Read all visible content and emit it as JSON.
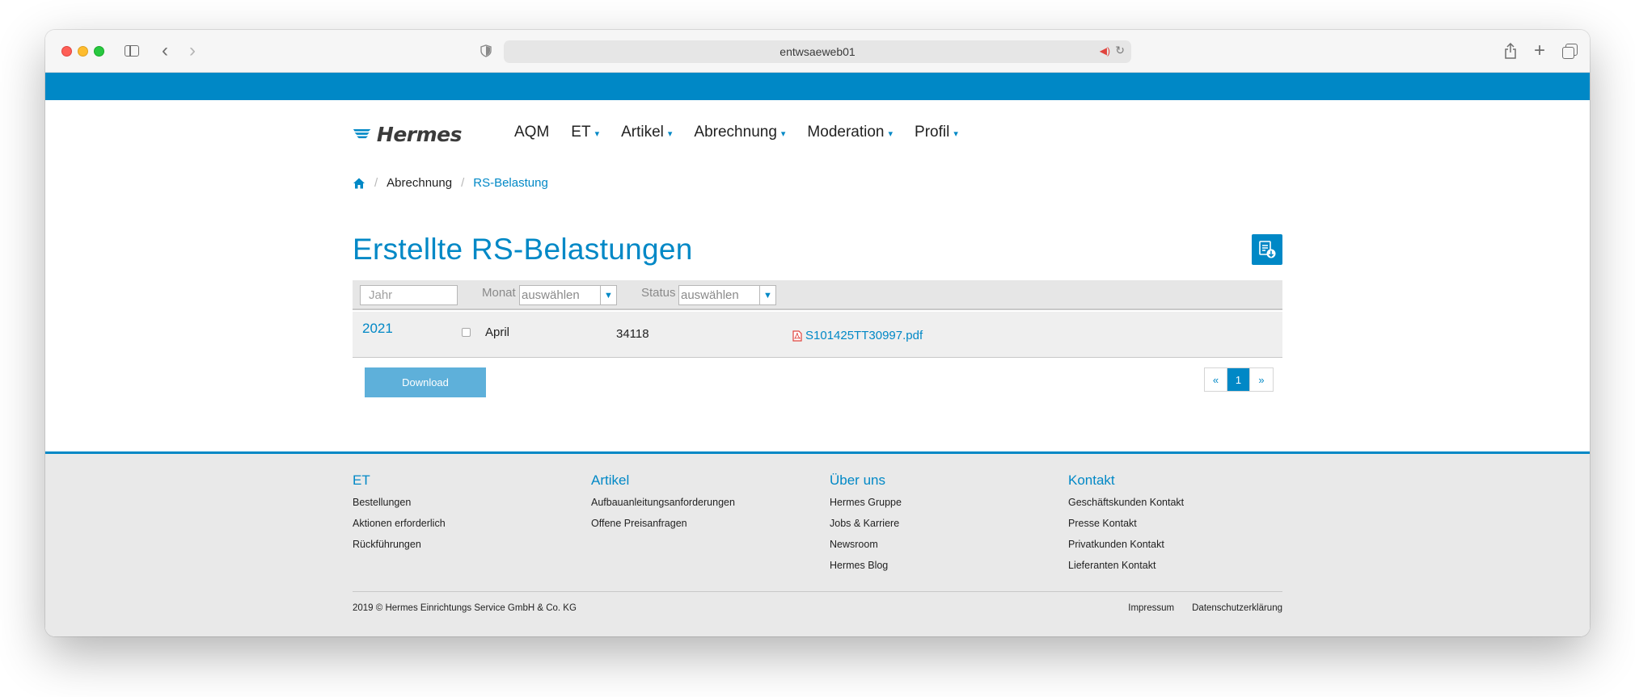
{
  "browser": {
    "url": "entwsaeweb01"
  },
  "brand": {
    "logo_text": "Hermes",
    "primary_color": "#0088c6"
  },
  "nav": {
    "items": [
      {
        "label": "AQM",
        "dropdown": false
      },
      {
        "label": "ET",
        "dropdown": true
      },
      {
        "label": "Artikel",
        "dropdown": true
      },
      {
        "label": "Abrechnung",
        "dropdown": true
      },
      {
        "label": "Moderation",
        "dropdown": true
      },
      {
        "label": "Profil",
        "dropdown": true
      }
    ]
  },
  "breadcrumb": {
    "home_icon": "home-icon",
    "items": [
      "Abrechnung",
      "RS-Belastung"
    ]
  },
  "main": {
    "title": "Erstellte RS-Belastungen",
    "export_icon": "document-download-icon"
  },
  "filters": {
    "year_placeholder": "Jahr",
    "month_label": "Monat",
    "month_value": "auswählen",
    "status_label": "Status",
    "status_value": "auswählen"
  },
  "rows": [
    {
      "year": "2021",
      "month": "April",
      "number": "34118",
      "file": "S101425TT30997.pdf",
      "file_icon": "pdf-icon"
    }
  ],
  "actions": {
    "download_label": "Download"
  },
  "pagination": {
    "prev": "«",
    "current": "1",
    "next": "»"
  },
  "footer": {
    "columns": [
      {
        "title": "ET",
        "items": [
          "Bestellungen",
          "Aktionen erforderlich",
          "Rückführungen"
        ]
      },
      {
        "title": "Artikel",
        "items": [
          "Aufbauanleitungsanforderungen",
          "Offene Preisanfragen"
        ]
      },
      {
        "title": "Über uns",
        "items": [
          "Hermes Gruppe",
          "Jobs & Karriere",
          "Newsroom",
          "Hermes Blog"
        ]
      },
      {
        "title": "Kontakt",
        "items": [
          "Geschäftskunden Kontakt",
          "Presse Kontakt",
          "Privatkunden Kontakt",
          "Lieferanten Kontakt"
        ]
      }
    ],
    "copyright": "2019 © Hermes Einrichtungs Service GmbH & Co. KG",
    "links": [
      "Impressum",
      "Datenschutzerklärung"
    ]
  }
}
